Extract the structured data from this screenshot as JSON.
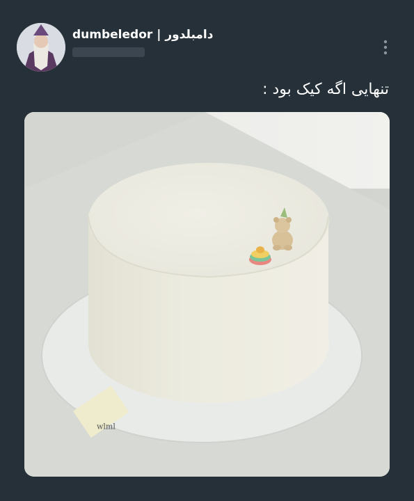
{
  "tweet": {
    "display_name": "dumbeledor | دامبلدور",
    "text": "تنهایی اگه کیک بود :",
    "media": {
      "tag_text": "wlml"
    },
    "icons": {
      "more": "more-vertical-icon"
    }
  },
  "colors": {
    "background": "#253038",
    "text": "#ffffff",
    "handle_blur": "#3b4650"
  }
}
